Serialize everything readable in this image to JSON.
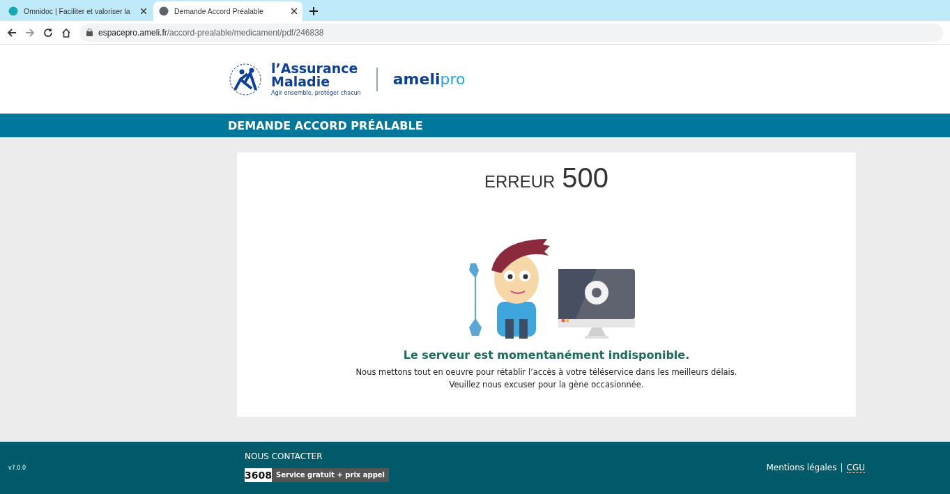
{
  "browser": {
    "tabs": [
      {
        "title": "Omnidoc | Faciliter et valoriser la",
        "selected": false
      },
      {
        "title": "Demande Accord Préalable",
        "selected": true
      }
    ],
    "address": {
      "host": "espacepro.ameli.fr",
      "path": "/accord-prealable/medicament/pdf/246838"
    }
  },
  "header": {
    "brand_line1": "l’Assurance",
    "brand_line2": "Maladie",
    "slogan": "Agir ensemble, protéger chacun",
    "product_a": "ameli",
    "product_b": "pro"
  },
  "page_title": "DEMANDE ACCORD PRÉALABLE",
  "error": {
    "label": "ERREUR",
    "code": "500",
    "headline": "Le serveur est momentanément indisponible.",
    "message_lines": [
      "Nous mettons tout en oeuvre pour rétablir l’accès à votre téléservice dans les meilleurs délais.",
      "Veuillez nous excuser pour la gène occasionnée."
    ]
  },
  "footer": {
    "version": "v7.0.0",
    "contact_title": "NOUS CONTACTER",
    "phone": "3608",
    "phone_note": "Service gratuit + prix appel",
    "links": [
      "Mentions légales",
      "CGU"
    ],
    "separator": "|"
  }
}
